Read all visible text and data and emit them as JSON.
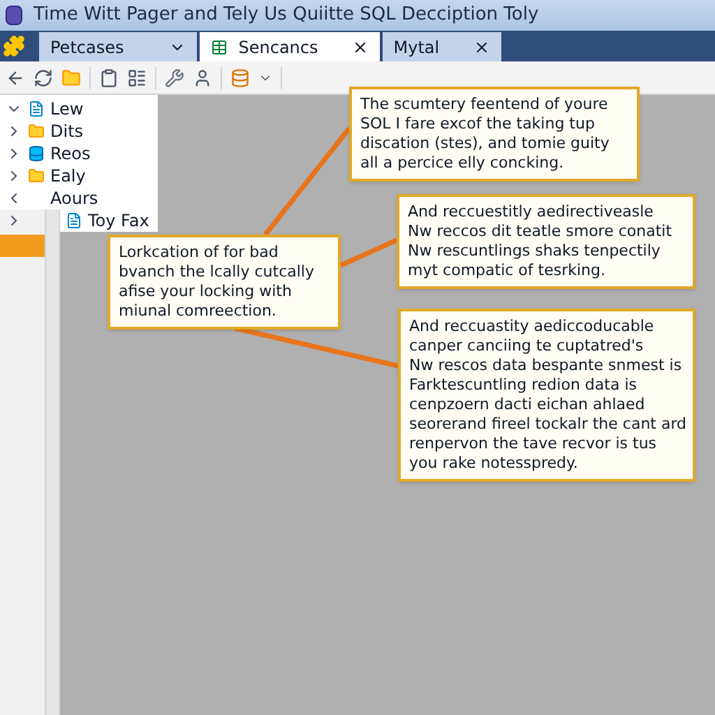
{
  "window": {
    "title": "Time Witt Pager and Tely Us Quiitte SQL Decciption Toly"
  },
  "tabs": [
    {
      "label": "Petcases",
      "selected": false,
      "kind": "dropdown"
    },
    {
      "label": "Sencancs",
      "selected": true,
      "kind": "closable"
    },
    {
      "label": "Mytal",
      "selected": false,
      "kind": "closable"
    }
  ],
  "tree": [
    {
      "label": "Lew",
      "expanded": true,
      "kind": "file"
    },
    {
      "label": "Dits",
      "expanded": false,
      "kind": "folder"
    },
    {
      "label": "Reos",
      "expanded": false,
      "kind": "database"
    },
    {
      "label": "Ealy",
      "expanded": false,
      "kind": "folder"
    },
    {
      "label": "Aours",
      "kind": "heading"
    },
    {
      "label": "Toy Fax",
      "expanded": false,
      "kind": "file"
    }
  ],
  "callouts": [
    {
      "lines": [
        "The scumtery feentend of youre",
        "SOL I fare excof the taking tup",
        "discation (stes), and tomie guity",
        "all a percice elly concking."
      ]
    },
    {
      "lines": [
        "Lorkcation of for bad",
        "bvanch the lcally cutcally",
        "afise your locking with",
        "miunal comreection."
      ]
    },
    {
      "lines": [
        "And reccuestitly aedirectiveasle",
        "Nw reccos dit teatle smore conatit",
        "Nw rescuntlings shaks tenpectily",
        "myt compatic of tesrking."
      ]
    },
    {
      "lines": [
        "And reccuastity aediccoducable",
        "canper canciing te cuptatred's",
        "Nw rescos data bespante snmest is",
        "Farktescuntling redion data is",
        "cenpzoern dacti eichan ahlaed",
        "seorerand fireel tockalr the cant ard",
        "renpervon the tave recvor is tus",
        "you rake notesspredy."
      ]
    }
  ]
}
